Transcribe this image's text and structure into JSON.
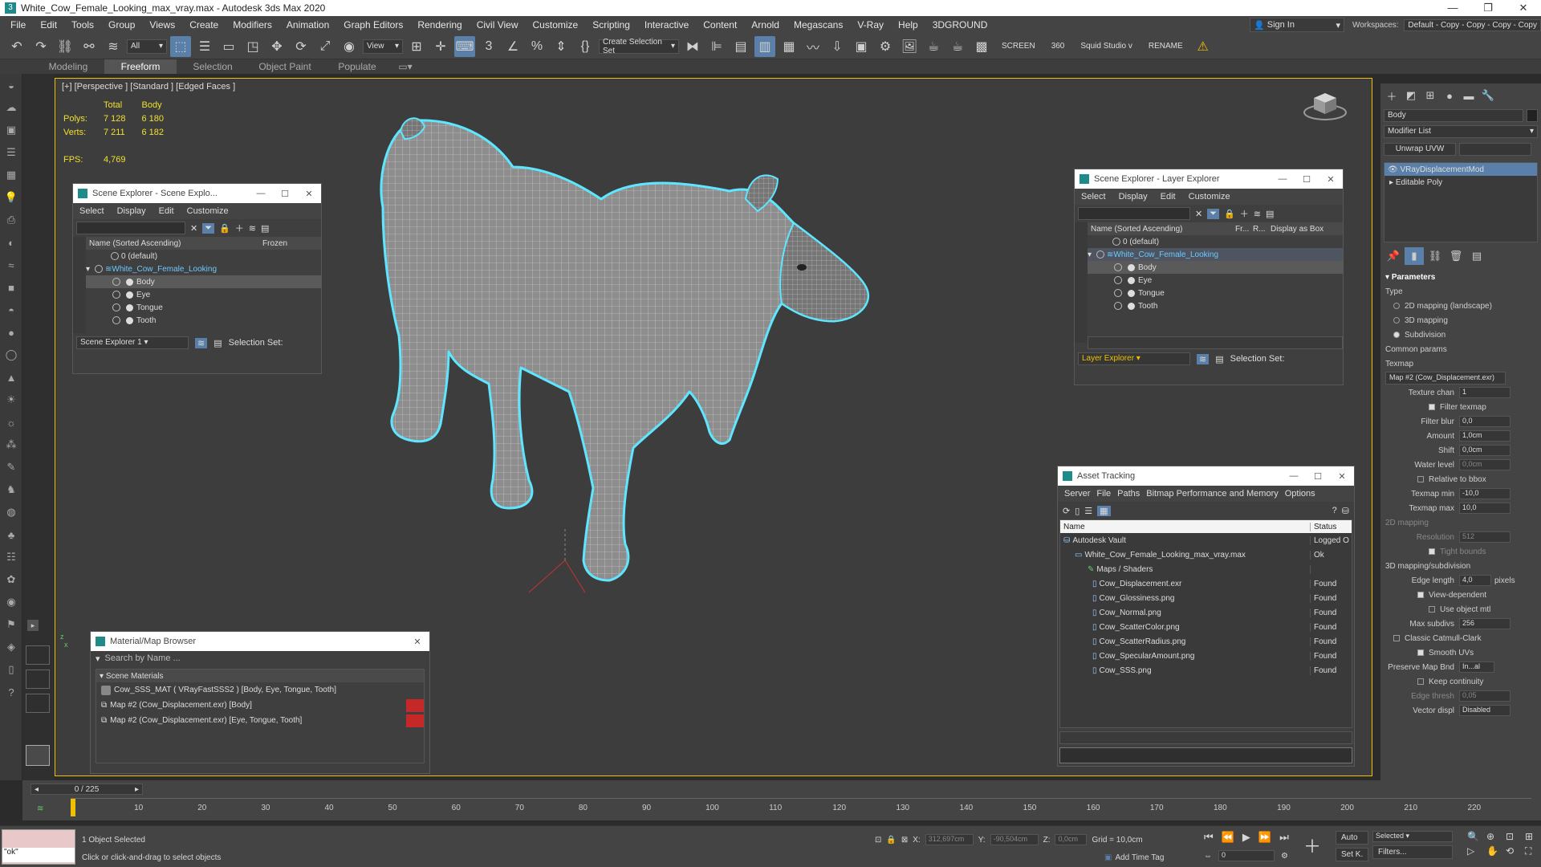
{
  "window": {
    "title": "White_Cow_Female_Looking_max_vray.max - Autodesk 3ds Max 2020"
  },
  "menu": [
    "File",
    "Edit",
    "Tools",
    "Group",
    "Views",
    "Create",
    "Modifiers",
    "Animation",
    "Graph Editors",
    "Rendering",
    "Civil View",
    "Customize",
    "Scripting",
    "Interactive",
    "Content",
    "Arnold",
    "Megascans",
    "V-Ray",
    "Help",
    "3DGROUND"
  ],
  "signin": "Sign In",
  "workspace": {
    "label": "Workspaces:",
    "value": "Default - Copy - Copy - Copy - Copy"
  },
  "toolbar": {
    "filter": "All",
    "view": "View",
    "selection_set": "Create Selection Set",
    "screen": "SCREEN",
    "num": "360",
    "squid": "Squid Studio v",
    "rename": "RENAME"
  },
  "ribbon": [
    "Modeling",
    "Freeform",
    "Selection",
    "Object Paint",
    "Populate"
  ],
  "viewport": {
    "label": "[+] [Perspective ] [Standard ] [Edged Faces ]",
    "stats": {
      "h_total": "Total",
      "h_body": "Body",
      "polys_label": "Polys:",
      "polys_total": "7 128",
      "polys_body": "6 180",
      "verts_label": "Verts:",
      "verts_total": "7 211",
      "verts_body": "6 182",
      "fps_label": "FPS:",
      "fps": "4,769"
    }
  },
  "scene_explorer": {
    "title": "Scene Explorer - Scene Explo...",
    "menu": [
      "Select",
      "Display",
      "Edit",
      "Customize"
    ],
    "col_name": "Name (Sorted Ascending)",
    "col_frozen": "Frozen",
    "rows": [
      "0 (default)",
      "White_Cow_Female_Looking",
      "Body",
      "Eye",
      "Tongue",
      "Tooth"
    ],
    "footer": "Scene Explorer 1",
    "selection_set": "Selection Set:"
  },
  "layer_explorer": {
    "title": "Scene Explorer - Layer Explorer",
    "menu": [
      "Select",
      "Display",
      "Edit",
      "Customize"
    ],
    "col_name": "Name (Sorted Ascending)",
    "col_fr": "Fr...",
    "col_r": "R...",
    "col_box": "Display as Box",
    "rows": [
      "0 (default)",
      "White_Cow_Female_Looking",
      "Body",
      "Eye",
      "Tongue",
      "Tooth"
    ],
    "footer": "Layer Explorer",
    "selection_set": "Selection Set:"
  },
  "asset_tracking": {
    "title": "Asset Tracking",
    "menu": [
      "Server",
      "File",
      "Paths",
      "Bitmap Performance and Memory",
      "Options"
    ],
    "col_name": "Name",
    "col_status": "Status",
    "rows": [
      {
        "name": "Autodesk Vault",
        "status": "Logged O"
      },
      {
        "name": "White_Cow_Female_Looking_max_vray.max",
        "status": "Ok"
      },
      {
        "name": "Maps / Shaders",
        "status": ""
      },
      {
        "name": "Cow_Displacement.exr",
        "status": "Found"
      },
      {
        "name": "Cow_Glossiness.png",
        "status": "Found"
      },
      {
        "name": "Cow_Normal.png",
        "status": "Found"
      },
      {
        "name": "Cow_ScatterColor.png",
        "status": "Found"
      },
      {
        "name": "Cow_ScatterRadius.png",
        "status": "Found"
      },
      {
        "name": "Cow_SpecularAmount.png",
        "status": "Found"
      },
      {
        "name": "Cow_SSS.png",
        "status": "Found"
      }
    ]
  },
  "material_browser": {
    "title": "Material/Map Browser",
    "search": "Search by Name ...",
    "group": "Scene Materials",
    "rows": [
      "Cow_SSS_MAT ( VRayFastSSS2 ) [Body, Eye, Tongue, Tooth]",
      "Map #2 (Cow_Displacement.exr) [Body]",
      "Map #2 (Cow_Displacement.exr) [Eye, Tongue, Tooth]"
    ]
  },
  "command_panel": {
    "object_name": "Body",
    "modifier_list": "Modifier List",
    "unwrap": "Unwrap UVW",
    "stack": [
      "VRayDisplacementMod",
      "Editable Poly"
    ],
    "params_title": "Parameters",
    "type_label": "Type",
    "types": [
      "2D mapping (landscape)",
      "3D mapping",
      "Subdivision"
    ],
    "common": "Common params",
    "texmap_label": "Texmap",
    "texmap": "Map #2 (Cow_Displacement.exr)",
    "texture_chan": {
      "label": "Texture chan",
      "value": "1"
    },
    "filter_texmap": "Filter texmap",
    "filter_blur": {
      "label": "Filter blur",
      "value": "0,0"
    },
    "amount": {
      "label": "Amount",
      "value": "1,0cm"
    },
    "shift": {
      "label": "Shift",
      "value": "0,0cm"
    },
    "water_level": {
      "label": "Water level",
      "value": "0,0cm"
    },
    "relative_bbox": "Relative to bbox",
    "texmap_min": {
      "label": "Texmap min",
      "value": "-10,0"
    },
    "texmap_max": {
      "label": "Texmap max",
      "value": "10,0"
    },
    "mapping2d": "2D mapping",
    "resolution": {
      "label": "Resolution",
      "value": "512"
    },
    "tight_bounds": "Tight bounds",
    "mapping3d": "3D mapping/subdivision",
    "edge_length": {
      "label": "Edge length",
      "value": "4,0",
      "unit": "pixels"
    },
    "view_dependent": "View-dependent",
    "use_object_mtl": "Use object mtl",
    "max_subdivs": {
      "label": "Max subdivs",
      "value": "256"
    },
    "catmull": "Classic Catmull-Clark",
    "smooth_uvs": "Smooth UVs",
    "preserve_map": {
      "label": "Preserve Map Bnd",
      "value": "In...al"
    },
    "keep_continuity": "Keep continuity",
    "edge_thresh": {
      "label": "Edge thresh",
      "value": "0,05"
    },
    "vector_displ": {
      "label": "Vector displ",
      "value": "Disabled"
    }
  },
  "timeline": {
    "frame": "0 / 225",
    "ticks": [
      "10",
      "20",
      "30",
      "40",
      "50",
      "60",
      "70",
      "80",
      "90",
      "100",
      "110",
      "120",
      "130",
      "140",
      "150",
      "160",
      "170",
      "180",
      "190",
      "200",
      "210",
      "220"
    ]
  },
  "status": {
    "script": "\"ok\"",
    "selected": "1 Object Selected",
    "prompt": "Click or click-and-drag to select objects",
    "x_label": "X:",
    "x": "312,697cm",
    "y_label": "Y:",
    "y": "-90,504cm",
    "z_label": "Z:",
    "z": "0,0cm",
    "grid": "Grid = 10,0cm",
    "add_time_tag": "Add Time Tag",
    "auto": "Auto",
    "set_key": "Set K.",
    "selected_mode": "Selected",
    "filters": "Filters...",
    "frame_field": "0"
  }
}
